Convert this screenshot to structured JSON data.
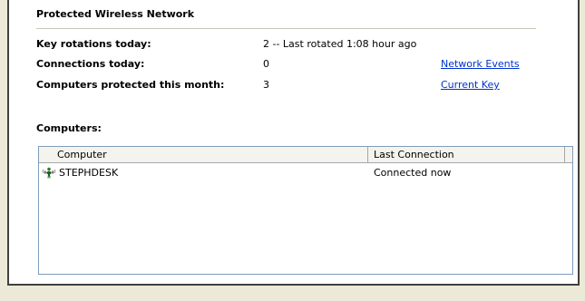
{
  "section": {
    "title": "Protected Wireless Network"
  },
  "stats": [
    {
      "label": "Key rotations today:",
      "value": "2 -- Last rotated 1:08 hour ago",
      "link": ""
    },
    {
      "label": "Connections today:",
      "value": "0",
      "link": "Network Events"
    },
    {
      "label": "Computers protected this month:",
      "value": "3",
      "link": "Current Key"
    }
  ],
  "computers": {
    "title": "Computers:",
    "columns": [
      "Computer",
      "Last Connection"
    ],
    "rows": [
      {
        "computer": "STEPHDESK",
        "last_connection": "Connected now",
        "icon": "wireless-computer-icon"
      }
    ]
  },
  "colors": {
    "link": "#0033cc",
    "panel_background": "#ffffff",
    "window_background": "#ece9d8"
  }
}
